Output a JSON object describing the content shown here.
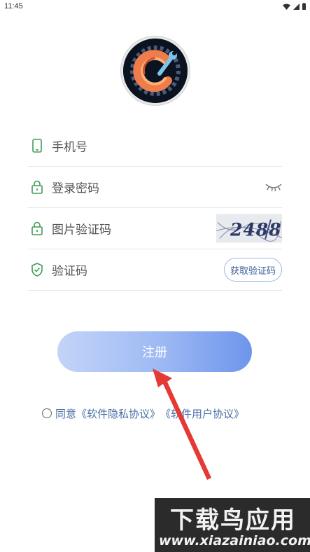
{
  "status_bar": {
    "time": "11:45",
    "icons": [
      "wifi-icon",
      "signal-icon",
      "battery-icon"
    ]
  },
  "form": {
    "phone": {
      "label": "手机号",
      "icon": "phone-icon"
    },
    "password": {
      "label": "登录密码",
      "icon": "lock-icon",
      "toggle_icon": "eye-closed-icon"
    },
    "image_captcha": {
      "label": "图片验证码",
      "icon": "lock-icon",
      "captcha_text": "2488"
    },
    "sms_code": {
      "label": "验证码",
      "icon": "shield-check-icon",
      "button_label": "获取验证码"
    }
  },
  "register_button_label": "注册",
  "agreement": {
    "prefix": "同意",
    "privacy_link": "《软件隐私协议》",
    "user_link": "《软件用户协议》"
  },
  "watermark": {
    "title": "下载鸟应用",
    "url": "www.xiazainiao.com"
  },
  "colors": {
    "icon_green": "#3f9d57",
    "link_blue": "#4a6fa5",
    "button_gradient_start": "#c3d4f9",
    "button_gradient_end": "#6e95ec",
    "arrow_red": "#e53935"
  }
}
